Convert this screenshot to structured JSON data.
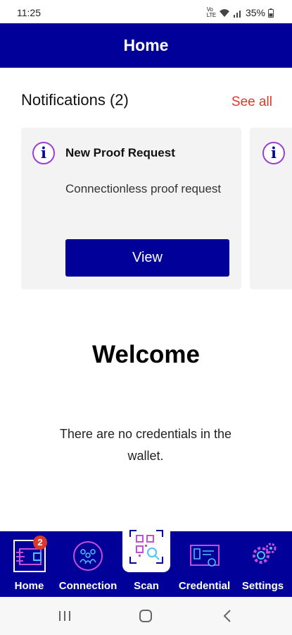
{
  "status": {
    "time": "11:25",
    "network": "VoLTE",
    "battery": "35%"
  },
  "appbar": {
    "title": "Home"
  },
  "notifications": {
    "header": "Notifications (2)",
    "see_all": "See all",
    "items": [
      {
        "title": "New Proof Request",
        "body": "Connectionless proof request",
        "button": "View"
      }
    ]
  },
  "main": {
    "welcome": "Welcome",
    "empty_message": "There are no credentials in the wallet."
  },
  "bottom_nav": {
    "items": [
      {
        "label": "Home",
        "icon": "wallet-icon",
        "badge": "2"
      },
      {
        "label": "Connection",
        "icon": "connection-icon"
      },
      {
        "label": "Scan",
        "icon": "qr-scan-icon"
      },
      {
        "label": "Credential",
        "icon": "credential-icon"
      },
      {
        "label": "Settings",
        "icon": "gear-icon"
      }
    ]
  },
  "colors": {
    "primary": "#010099",
    "accent": "#d93a2b",
    "icon_accent": "#9b3fd4"
  }
}
